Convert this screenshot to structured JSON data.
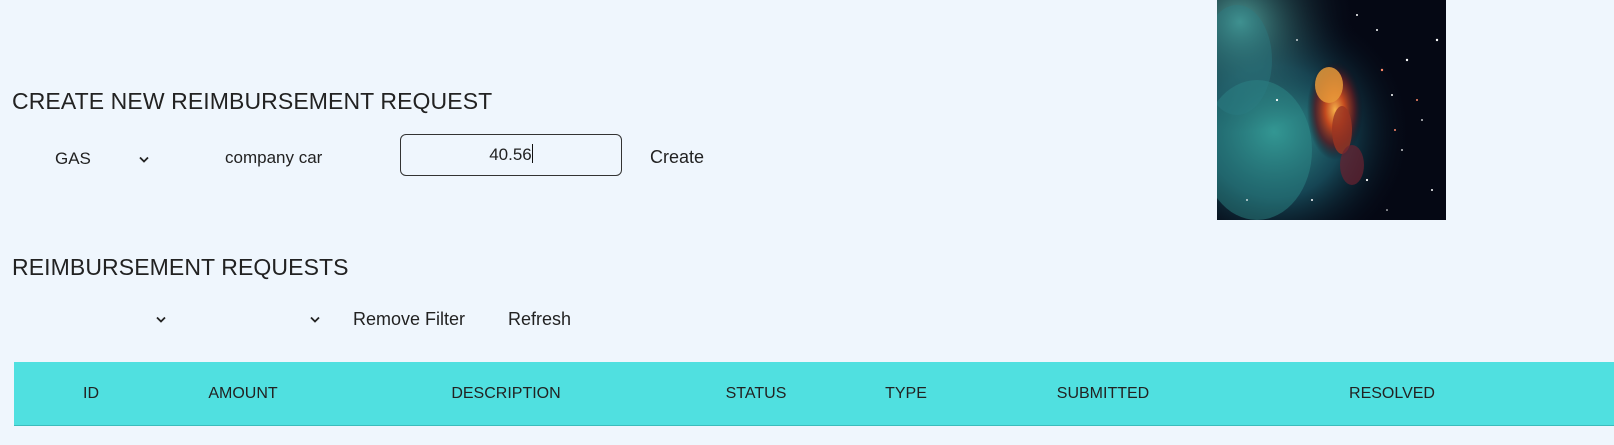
{
  "create_section": {
    "heading": "CREATE NEW REIMBURSEMENT REQUEST",
    "type_select": {
      "selected": "GAS",
      "icon": "chevron-down-icon"
    },
    "description": "company car",
    "amount": "40.56",
    "create_label": "Create"
  },
  "list_section": {
    "heading": "REIMBURSEMENT REQUESTS",
    "filter_status": {
      "selected": "",
      "icon": "chevron-down-icon"
    },
    "filter_type": {
      "selected": "",
      "icon": "chevron-down-icon"
    },
    "remove_filter_label": "Remove Filter",
    "refresh_label": "Refresh"
  },
  "table": {
    "header_color": "#50e0e0",
    "columns": [
      "ID",
      "AMOUNT",
      "DESCRIPTION",
      "STATUS",
      "TYPE",
      "SUBMITTED",
      "RESOLVED"
    ]
  },
  "decor": {
    "image": "nebula-space-image"
  },
  "colors": {
    "background": "#eff6fd",
    "accent": "#50e0e0"
  }
}
